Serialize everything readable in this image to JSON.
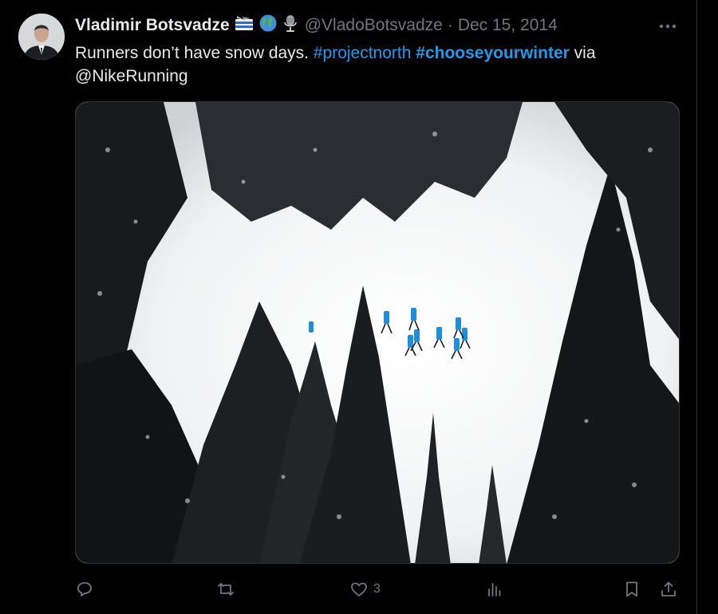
{
  "author": {
    "display_name": "Vladimir Botsvadze",
    "badges": [
      "flag-emoji",
      "globe-emoji",
      "microphone-emoji"
    ],
    "handle": "@VladoBotsvadze",
    "separator": "·",
    "date": "Dec 15, 2014"
  },
  "tweet": {
    "text_plain": "Runners don’t have snow days. ",
    "hashtag_1": "#projectnorth",
    "space": " ",
    "hashtag_2": "#chooseyourwinter",
    "text_via": " via",
    "mention": "@NikeRunning"
  },
  "media": {
    "description_icon": "photo",
    "runner_color": "#1d8fe0"
  },
  "actions": {
    "reply_count": "",
    "retweet_count": "",
    "like_count": "3",
    "views_count": ""
  },
  "colors": {
    "background": "#000000",
    "text": "#e7e9ea",
    "muted": "#71767b",
    "link": "#1d9bf0"
  }
}
